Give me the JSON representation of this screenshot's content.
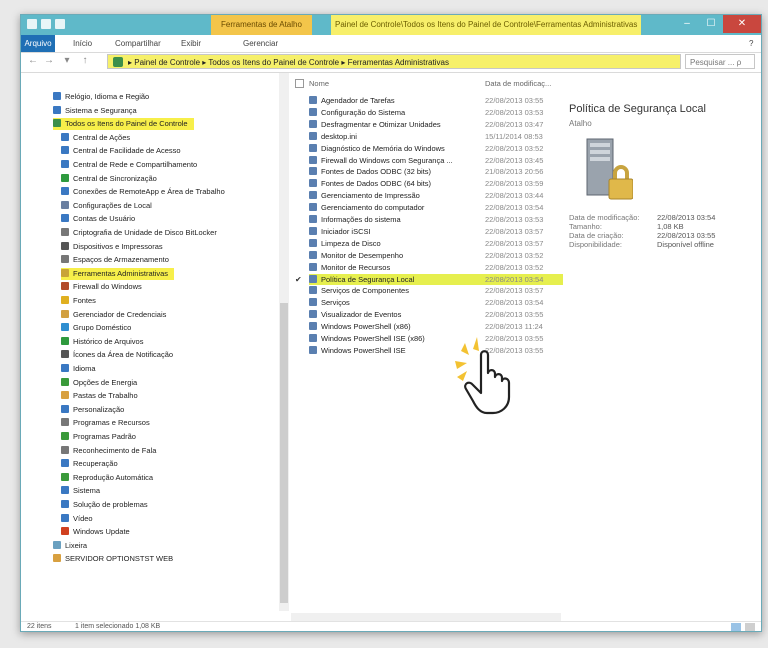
{
  "window": {
    "tools_tab": "Ferramentas de Atalho",
    "title": "Painel de Controle\\Todos os Itens do Painel de Controle\\Ferramentas Administrativas",
    "minimize": "–",
    "maximize": "☐",
    "close": "✕"
  },
  "ribbon": {
    "tabs": [
      "Arquivo",
      "Início",
      "Compartilhar",
      "Exibir",
      "Gerenciar"
    ]
  },
  "address": {
    "path": "▸ Painel de Controle ▸ Todos os Itens do Painel de Controle ▸ Ferramentas Administrativas",
    "search_placeholder": "Pesquisar ... ρ"
  },
  "nav": {
    "items": [
      {
        "label": "Relógio, Idioma e Região",
        "color": "#3a78c2",
        "indent": 0
      },
      {
        "label": "Sistema e Segurança",
        "color": "#3a78c2",
        "indent": 0
      },
      {
        "label": "Todos os Itens do Painel de Controle",
        "color": "#3c8f4a",
        "indent": 0,
        "highlight": true
      },
      {
        "label": "Central de Ações",
        "color": "#3a78c2",
        "indent": 1
      },
      {
        "label": "Central de Facilidade de Acesso",
        "color": "#3a78c2",
        "indent": 1
      },
      {
        "label": "Central de Rede e Compartilhamento",
        "color": "#3a78c2",
        "indent": 1
      },
      {
        "label": "Central de Sincronização",
        "color": "#2e9a3e",
        "indent": 1
      },
      {
        "label": "Conexões de RemoteApp e Área de Trabalho",
        "color": "#3a78c2",
        "indent": 1
      },
      {
        "label": "Configurações de Local",
        "color": "#6a7fa0",
        "indent": 1
      },
      {
        "label": "Contas de Usuário",
        "color": "#3a78c2",
        "indent": 1
      },
      {
        "label": "Criptografia de Unidade de Disco BitLocker",
        "color": "#777777",
        "indent": 1
      },
      {
        "label": "Dispositivos e Impressoras",
        "color": "#555555",
        "indent": 1
      },
      {
        "label": "Espaços de Armazenamento",
        "color": "#777777",
        "indent": 1
      },
      {
        "label": "Ferramentas Administrativas",
        "color": "#c8a438",
        "indent": 1,
        "highlight": true
      },
      {
        "label": "Firewall do Windows",
        "color": "#b24a2a",
        "indent": 1
      },
      {
        "label": "Fontes",
        "color": "#e0b020",
        "indent": 1
      },
      {
        "label": "Gerenciador de Credenciais",
        "color": "#d2a040",
        "indent": 1
      },
      {
        "label": "Grupo Doméstico",
        "color": "#2f8ed0",
        "indent": 1
      },
      {
        "label": "Histórico de Arquivos",
        "color": "#2e9a3e",
        "indent": 1
      },
      {
        "label": "Ícones da Área de Notificação",
        "color": "#555555",
        "indent": 1
      },
      {
        "label": "Idioma",
        "color": "#3a78c2",
        "indent": 1
      },
      {
        "label": "Opções de Energia",
        "color": "#3a9a3a",
        "indent": 1
      },
      {
        "label": "Pastas de Trabalho",
        "color": "#d8a040",
        "indent": 1
      },
      {
        "label": "Personalização",
        "color": "#3a78c2",
        "indent": 1
      },
      {
        "label": "Programas e Recursos",
        "color": "#777777",
        "indent": 1
      },
      {
        "label": "Programas Padrão",
        "color": "#3a9a3a",
        "indent": 1
      },
      {
        "label": "Reconhecimento de Fala",
        "color": "#777777",
        "indent": 1
      },
      {
        "label": "Recuperação",
        "color": "#3a78c2",
        "indent": 1
      },
      {
        "label": "Reprodução Automática",
        "color": "#3a9a3a",
        "indent": 1
      },
      {
        "label": "Sistema",
        "color": "#3a78c2",
        "indent": 1
      },
      {
        "label": "Solução de problemas",
        "color": "#3a78c2",
        "indent": 1
      },
      {
        "label": "Vídeo",
        "color": "#3a78c2",
        "indent": 1
      },
      {
        "label": "Windows Update",
        "color": "#d04020",
        "indent": 1
      },
      {
        "label": "Lixeira",
        "color": "#6aa0c0",
        "indent": 0
      },
      {
        "label": "SERVIDOR OPTIONSTST WEB",
        "color": "#d8a040",
        "indent": 0
      }
    ]
  },
  "content": {
    "col_name": "Nome",
    "col_date": "Data de modificaç...",
    "files": [
      {
        "name": "Agendador de Tarefas",
        "date": "22/08/2013 03:55"
      },
      {
        "name": "Configuração do Sistema",
        "date": "22/08/2013 03:53"
      },
      {
        "name": "Desfragmentar e Otimizar Unidades",
        "date": "22/08/2013 03:47"
      },
      {
        "name": "desktop.ini",
        "date": "15/11/2014 08:53"
      },
      {
        "name": "Diagnóstico de Memória do Windows",
        "date": "22/08/2013 03:52"
      },
      {
        "name": "Firewall do Windows com Segurança ...",
        "date": "22/08/2013 03:45"
      },
      {
        "name": "Fontes de Dados ODBC (32 bits)",
        "date": "21/08/2013 20:56"
      },
      {
        "name": "Fontes de Dados ODBC (64 bits)",
        "date": "22/08/2013 03:59"
      },
      {
        "name": "Gerenciamento de Impressão",
        "date": "22/08/2013 03:44"
      },
      {
        "name": "Gerenciamento do computador",
        "date": "22/08/2013 03:54"
      },
      {
        "name": "Informações do sistema",
        "date": "22/08/2013 03:53"
      },
      {
        "name": "Iniciador iSCSI",
        "date": "22/08/2013 03:57"
      },
      {
        "name": "Limpeza de Disco",
        "date": "22/08/2013 03:57"
      },
      {
        "name": "Monitor de Desempenho",
        "date": "22/08/2013 03:52"
      },
      {
        "name": "Monitor de Recursos",
        "date": "22/08/2013 03:52"
      },
      {
        "name": "Política de Segurança Local",
        "date": "22/08/2013 03:54",
        "highlight": true
      },
      {
        "name": "Serviços de Componentes",
        "date": "22/08/2013 03:57"
      },
      {
        "name": "Serviços",
        "date": "22/08/2013 03:54"
      },
      {
        "name": "Visualizador de Eventos",
        "date": "22/08/2013 03:55"
      },
      {
        "name": "Windows PowerShell (x86)",
        "date": "22/08/2013 11:24"
      },
      {
        "name": "Windows PowerShell ISE (x86)",
        "date": "22/08/2013 03:55"
      },
      {
        "name": "Windows PowerShell ISE",
        "date": "22/08/2013 03:55"
      }
    ]
  },
  "details": {
    "title": "Política de Segurança Local",
    "type": "Atalho",
    "rows": [
      {
        "label": "Data de modificação:",
        "value": "22/08/2013 03:54"
      },
      {
        "label": "Tamanho:",
        "value": "1,08 KB"
      },
      {
        "label": "Data de criação:",
        "value": "22/08/2013 03:55"
      },
      {
        "label": "Disponibilidade:",
        "value": "Disponível offline"
      }
    ]
  },
  "status": {
    "items_count": "22 itens",
    "selected": "1 item selecionado  1,08 KB"
  },
  "colors": {
    "accent": "#5fb9c9",
    "highlight": "#f7ef4a",
    "file_blue": "#1f6fb5"
  }
}
